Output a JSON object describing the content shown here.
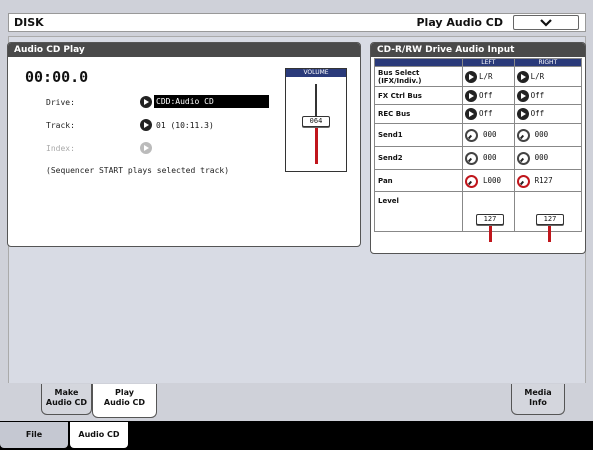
{
  "title_bar": {
    "mode": "DISK",
    "page": "Play Audio CD"
  },
  "audio_cd_play": {
    "header": "Audio CD Play",
    "time": "00:00.0",
    "drive_label": "Drive:",
    "drive_value": "CDD:Audio CD",
    "track_label": "Track:",
    "track_value": "01 (10:11.3)",
    "index_label": "Index:",
    "note": "(Sequencer START plays selected track)",
    "volume_label": "VOLUME",
    "volume_value": "064"
  },
  "drive_input": {
    "header": "CD-R/RW Drive Audio Input",
    "col_left": "LEFT",
    "col_right": "RIGHT",
    "rows": {
      "bus_select": {
        "label": "Bus Select (IFX/Indiv.)",
        "left": "L/R",
        "right": "L/R"
      },
      "fx_ctrl": {
        "label": "FX Ctrl Bus",
        "left": "Off",
        "right": "Off"
      },
      "rec_bus": {
        "label": "REC Bus",
        "left": "Off",
        "right": "Off"
      },
      "send1": {
        "label": "Send1",
        "left": "000",
        "right": "000"
      },
      "send2": {
        "label": "Send2",
        "left": "000",
        "right": "000"
      },
      "pan": {
        "label": "Pan",
        "left": "L000",
        "right": "R127"
      },
      "level": {
        "label": "Level",
        "left": "127",
        "right": "127"
      }
    }
  },
  "page_tabs": [
    {
      "line1": "Make",
      "line2": "Audio CD"
    },
    {
      "line1": "Play",
      "line2": "Audio CD"
    },
    {
      "line1": "Media",
      "line2": "Info"
    }
  ],
  "bottom_tabs": {
    "file": "File",
    "audio_cd": "Audio CD"
  }
}
